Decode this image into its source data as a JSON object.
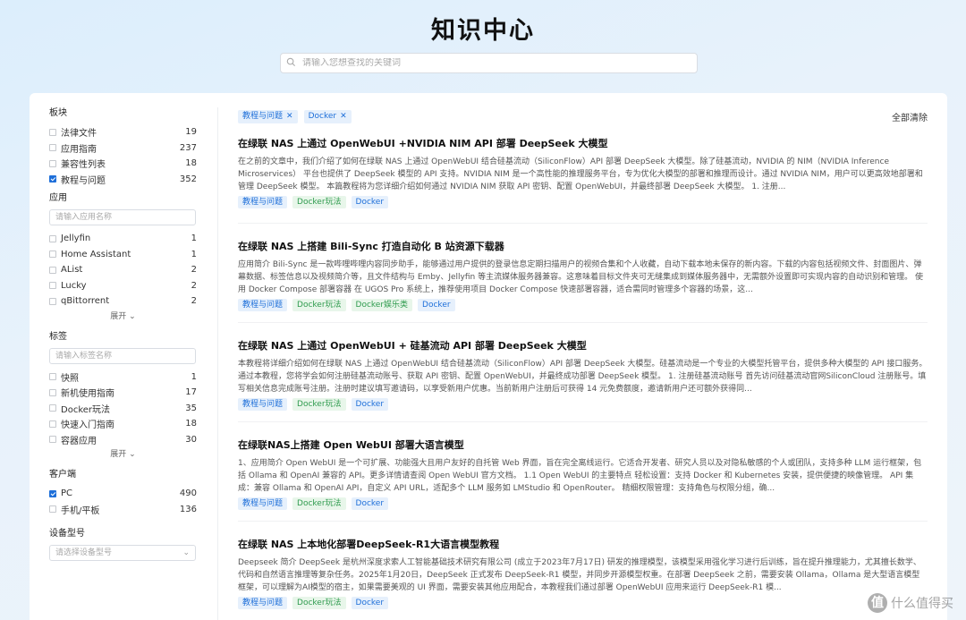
{
  "header": {
    "title": "知识中心",
    "search_placeholder": "请输入您想查找的关键词"
  },
  "sidebar": {
    "category": {
      "title": "板块",
      "items": [
        {
          "label": "法律文件",
          "count": "19",
          "checked": false
        },
        {
          "label": "应用指南",
          "count": "237",
          "checked": false
        },
        {
          "label": "兼容性列表",
          "count": "18",
          "checked": false
        },
        {
          "label": "教程与问题",
          "count": "352",
          "checked": true
        }
      ]
    },
    "apps": {
      "title": "应用",
      "placeholder": "请输入应用名称",
      "items": [
        {
          "label": "Jellyfin",
          "count": "1",
          "checked": false
        },
        {
          "label": "Home Assistant",
          "count": "1",
          "checked": false
        },
        {
          "label": "AList",
          "count": "2",
          "checked": false
        },
        {
          "label": "Lucky",
          "count": "2",
          "checked": false
        },
        {
          "label": "qBittorrent",
          "count": "2",
          "checked": false
        }
      ],
      "expand": "展开"
    },
    "tags": {
      "title": "标签",
      "placeholder": "请输入标签名称",
      "items": [
        {
          "label": "快照",
          "count": "1",
          "checked": false
        },
        {
          "label": "新机使用指南",
          "count": "17",
          "checked": false
        },
        {
          "label": "Docker玩法",
          "count": "35",
          "checked": false
        },
        {
          "label": "快速入门指南",
          "count": "18",
          "checked": false
        },
        {
          "label": "容器应用",
          "count": "30",
          "checked": false
        }
      ],
      "expand": "展开"
    },
    "clients": {
      "title": "客户端",
      "items": [
        {
          "label": "PC",
          "count": "490",
          "checked": true
        },
        {
          "label": "手机/平板",
          "count": "136",
          "checked": false
        }
      ]
    },
    "device": {
      "title": "设备型号",
      "placeholder": "请选择设备型号"
    }
  },
  "filters": {
    "active": [
      "教程与问题",
      "Docker"
    ],
    "clear_all": "全部清除"
  },
  "articles": [
    {
      "title": "在绿联 NAS 上通过 OpenWebUI +NVIDIA NIM API 部署 DeepSeek 大模型",
      "body": "在之前的文章中，我们介绍了如何在绿联 NAS 上通过 OpenWebUI 结合硅基流动（SiliconFlow）API 部署 DeepSeek 大模型。除了硅基流动，NVIDIA 的 NIM（NVIDIA Inference Microservices） 平台也提供了 DeepSeek 模型的 API 支持。NVIDIA NIM 是一个高性能的推理服务平台，专为优化大模型的部署和推理而设计。通过 NVIDIA NIM，用户可以更高效地部署和管理 DeepSeek 模型。 本篇教程将为您详细介绍如何通过 NVIDIA NIM 获取 API 密钥、配置 OpenWebUI，并最终部署 DeepSeek 大模型。 1. 注册...",
      "tags": [
        {
          "label": "教程与问题",
          "color": "blue"
        },
        {
          "label": "Docker玩法",
          "color": "green"
        },
        {
          "label": "Docker",
          "color": "blue"
        }
      ]
    },
    {
      "title": "在绿联 NAS 上搭建 Bili-Sync 打造自动化 B 站资源下载器",
      "body": "应用简介 Bili-Sync 是一款哔哩哔哩内容同步助手，能够通过用户提供的登录信息定期扫描用户的视频合集和个人收藏，自动下载本地未保存的新内容。下载的内容包括视频文件、封面图片、弹幕数据、标签信息以及视频简介等，且文件结构与 Emby、Jellyfin 等主流媒体服务器兼容。这意味着目标文件夹可无缝集成到媒体服务器中，无需额外设置即可实现内容的自动识别和管理。 使用 Docker Compose 部署容器 在 UGOS Pro 系统上，推荐使用项目 Docker Compose 快速部署容器，适合需同时管理多个容器的场景，这...",
      "tags": [
        {
          "label": "教程与问题",
          "color": "blue"
        },
        {
          "label": "Docker玩法",
          "color": "green"
        },
        {
          "label": "Docker娱乐类",
          "color": "green"
        },
        {
          "label": "Docker",
          "color": "blue"
        }
      ]
    },
    {
      "title": "在绿联 NAS 上通过 OpenWebUI + 硅基流动 API 部署 DeepSeek 大模型",
      "body": "本教程将详细介绍如何在绿联 NAS 上通过 OpenWebUI 结合硅基流动（SiliconFlow）API 部署 DeepSeek 大模型。硅基流动是一个专业的大模型托管平台，提供多种大模型的 API 接口服务。通过本教程，您将学会如何注册硅基流动账号、获取 API 密钥、配置 OpenWebUI，并最终成功部署 DeepSeek 模型。 1. 注册硅基流动账号 首先访问硅基流动官网SiliconCloud 注册账号。填写相关信息完成账号注册。注册时建议填写邀请码，以享受新用户优惠。当前新用户注册后可获得 14 元免费额度，邀请新用户还可额外获得同...",
      "tags": [
        {
          "label": "教程与问题",
          "color": "blue"
        },
        {
          "label": "Docker玩法",
          "color": "green"
        },
        {
          "label": "Docker",
          "color": "blue"
        }
      ]
    },
    {
      "title": "在绿联NAS上搭建 Open WebUI 部署大语言模型",
      "body": "1、应用简介 Open WebUI 是一个可扩展、功能强大且用户友好的自托管 Web 界面，旨在完全离线运行。它适合开发者、研究人员以及对隐私敏感的个人或团队，支持多种 LLM 运行框架，包括 Ollama 和 OpenAI 兼容的 API。更多详情请查阅 Open WebUI 官方文档。 1.1 Open WebUI 的主要特点 轻松设置：支持 Docker 和 Kubernetes 安装，提供便捷的映像管理。 API 集成：兼容 Ollama 和 OpenAI API，自定义 API URL，适配多个 LLM 服务如 LMStudio 和 OpenRouter。 精细权限管理：支持角色与权限分组，确...",
      "tags": [
        {
          "label": "教程与问题",
          "color": "blue"
        },
        {
          "label": "Docker玩法",
          "color": "green"
        },
        {
          "label": "Docker",
          "color": "blue"
        }
      ]
    },
    {
      "title": "在绿联 NAS 上本地化部署DeepSeek-R1大语言模型教程",
      "body": "Deepseek 简介 DeepSeek 是杭州深度求索人工智能基础技术研究有限公司 (成立于2023年7月17日) 研发的推理模型，该模型采用强化学习进行后训练，旨在提升推理能力，尤其擅长数学、代码和自然语言推理等复杂任务。2025年1月20日，DeepSeek 正式发布 DeepSeek-R1 模型，并同步开源模型权重。在部署 DeepSeek 之前，需要安装 Ollama，Ollama 是大型语言模型框架，可以理解为AI模型的宿主，如果需要美观的 UI 界面，需要安装其他应用配合，本教程我们通过部署 OpenWebUI 应用来运行 DeepSeek-R1 模...",
      "tags": [
        {
          "label": "教程与问题",
          "color": "blue"
        },
        {
          "label": "Docker玩法",
          "color": "green"
        },
        {
          "label": "Docker",
          "color": "blue"
        }
      ]
    }
  ],
  "watermark": {
    "badge": "值",
    "text": "什么值得买"
  }
}
